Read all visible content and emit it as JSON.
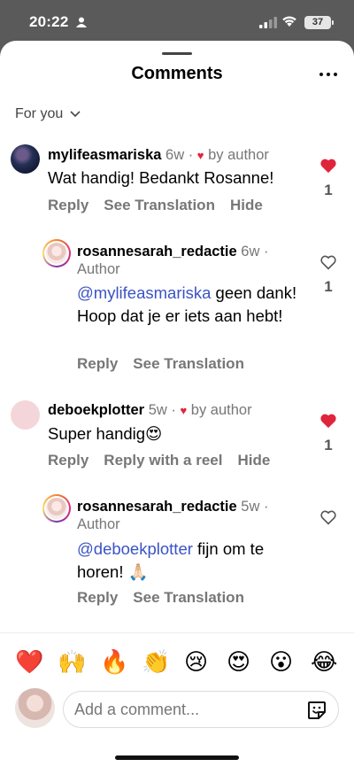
{
  "status": {
    "time": "20:22",
    "battery": "37"
  },
  "header": {
    "title": "Comments",
    "filter_label": "For you"
  },
  "comments": [
    {
      "username": "mylifeasmariska",
      "age": "6w",
      "liked_by": "by author",
      "text": "Wat handig! Bedankt Rosanne!",
      "actions": [
        "Reply",
        "See Translation",
        "Hide"
      ],
      "like_count": "1"
    },
    {
      "username": "rosannesarah_redactie",
      "age": "6w",
      "role": "Author",
      "mention": "@mylifeasmariska",
      "text": " geen dank! Hoop dat je er iets aan hebt!",
      "actions": [
        "Reply",
        "See Translation"
      ],
      "like_count": "1"
    },
    {
      "username": "deboekplotter",
      "age": "5w",
      "liked_by": "by author",
      "text": "Super handig😍",
      "actions": [
        "Reply",
        "Reply with a reel",
        "Hide"
      ],
      "like_count": "1"
    },
    {
      "username": "rosannesarah_redactie",
      "age": "5w",
      "role": "Author",
      "mention": "@deboekplotter",
      "text": " fijn om te horen! 🙏🏻",
      "actions": [
        "Reply",
        "See Translation"
      ]
    }
  ],
  "emoji_bar": [
    "❤️",
    "🙌",
    "🔥",
    "👏",
    "😢",
    "😍",
    "😮",
    "😂"
  ],
  "composer": {
    "placeholder": "Add a comment..."
  },
  "colors": {
    "heart": "#e0243c",
    "mention": "#3a53c5"
  }
}
